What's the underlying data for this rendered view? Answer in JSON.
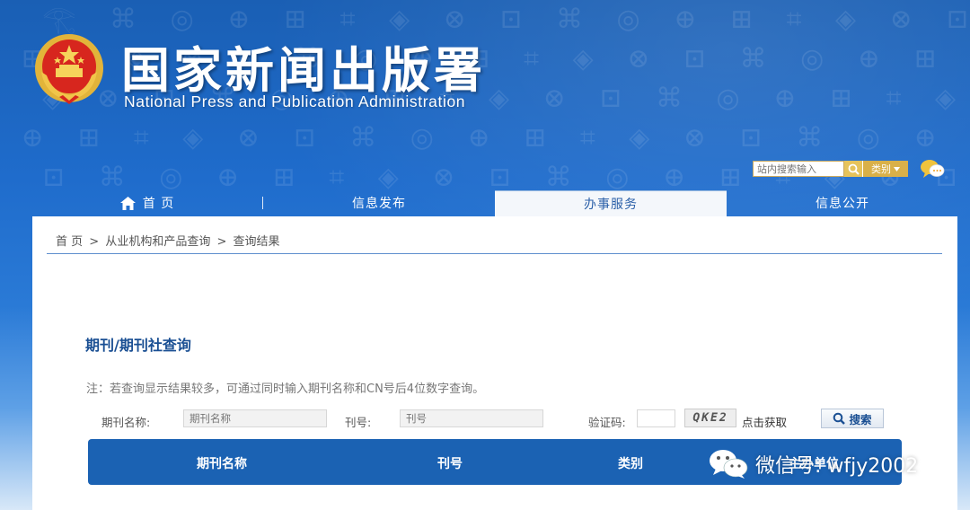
{
  "header": {
    "title_cn": "国家新闻出版署",
    "title_en": "National Press and Publication Administration"
  },
  "site_search": {
    "placeholder": "站内搜索输入",
    "category_label": "类别"
  },
  "nav": {
    "items": [
      {
        "label": "首 页",
        "active": false
      },
      {
        "label": "信息发布",
        "active": false
      },
      {
        "label": "办事服务",
        "active": true
      },
      {
        "label": "信息公开",
        "active": false
      }
    ]
  },
  "breadcrumb": {
    "home": "首 页",
    "sep1": ">",
    "level1": "从业机构和产品查询",
    "sep2": ">",
    "current": "查询结果"
  },
  "query": {
    "title": "期刊/期刊社查询",
    "note": "注：若查询显示结果较多，可通过同时输入期刊名称和CN号后4位数字查询。",
    "name_label": "期刊名称:",
    "name_placeholder": "期刊名称",
    "issn_label": "刊号:",
    "issn_placeholder": "刊号",
    "captcha_label": "验证码:",
    "captcha_code": "QKE2",
    "captcha_link": "点击获取",
    "search_button": "搜索"
  },
  "results_table": {
    "columns": [
      "期刊名称",
      "刊号",
      "类别",
      "主办单位"
    ]
  },
  "watermark": {
    "text": "微信号: wfjy2002"
  },
  "colors": {
    "header_blue": "#1a5fb4",
    "title_blue": "#1a4f93",
    "table_header": "#1b62b3",
    "gold": "#d9b049",
    "emblem_red": "#d7261e"
  }
}
